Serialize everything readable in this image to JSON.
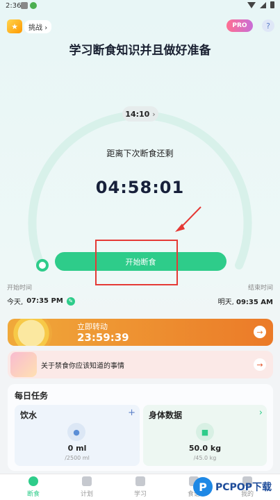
{
  "status_bar": {
    "time": "2:36"
  },
  "header": {
    "challenge_label": "挑战",
    "challenge_chevron": "›",
    "pro_label": "PRO",
    "help_label": "?"
  },
  "headline": "学习断食知识并且做好准备",
  "timer": {
    "selected_time": "14:10",
    "time_chevron": "›",
    "countdown_label": "距离下次断食还剩",
    "countdown": "04:58:01",
    "start_button": "开始断食",
    "start_label": "开始时间",
    "start_day": "今天,",
    "start_time": "07:35 PM",
    "end_label": "结束时间",
    "end_day": "明天,",
    "end_time": "09:35 AM"
  },
  "spin": {
    "title": "立即转动",
    "timer": "23:59:39",
    "arrow": "→"
  },
  "info": {
    "text": "关于禁食你应该知道的事情",
    "arrow": "→"
  },
  "daily": {
    "title": "每日任务",
    "water": {
      "name": "饮水",
      "action": "+",
      "value": "0 ml",
      "target": "/2500 ml"
    },
    "body": {
      "name": "身体数据",
      "action": "›",
      "value": "50.0 kg",
      "target": "/45.0 kg"
    }
  },
  "tabs": [
    {
      "label": "断食",
      "active": true
    },
    {
      "label": "计划"
    },
    {
      "label": "学习"
    },
    {
      "label": "食谱"
    },
    {
      "label": "我的"
    }
  ],
  "watermark": {
    "logo": "P",
    "text": "PCPOP下载"
  },
  "colors": {
    "accent": "#2ecc8a",
    "dial_track": "#d8f1ea",
    "highlight": "#e53935",
    "banner": "#f0a83a"
  },
  "icons": {
    "help": "help-icon",
    "trophy": "trophy-icon",
    "edit": "pencil-icon",
    "water": "water-drop-icon",
    "scale": "scale-icon",
    "arrow": "arrow-right-icon"
  }
}
